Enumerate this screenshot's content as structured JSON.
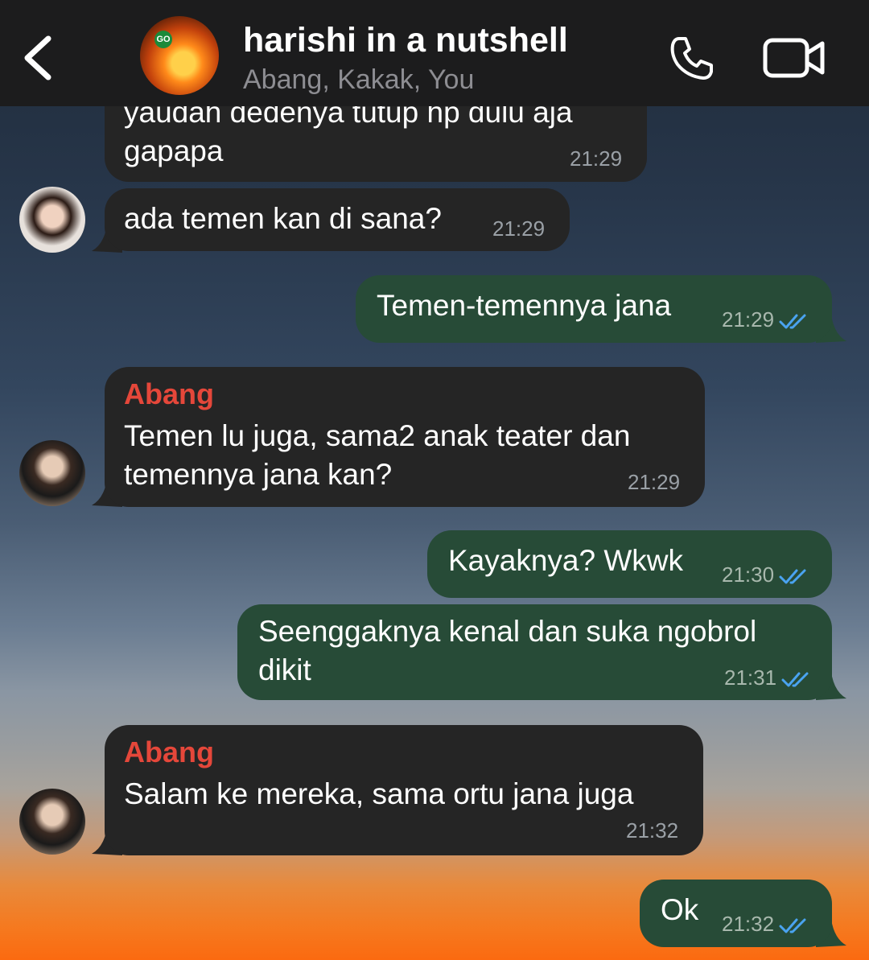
{
  "header": {
    "title": "harishi in a nutshell",
    "subtitle": "Abang, Kakak, You"
  },
  "messages": [
    {
      "type": "in",
      "text": "yaudah dedenya tutup hp dulu aja\ngapapa",
      "time": "21:29"
    },
    {
      "type": "in",
      "text": "ada temen kan di sana?",
      "time": "21:29"
    },
    {
      "type": "out",
      "text": "Temen-temennya jana",
      "time": "21:29",
      "status": "read"
    },
    {
      "type": "in",
      "sender": "Abang",
      "text": "Temen lu juga, sama2 anak teater dan\ntemennya jana kan?",
      "time": "21:29"
    },
    {
      "type": "out",
      "text": "Kayaknya? Wkwk",
      "time": "21:30",
      "status": "read"
    },
    {
      "type": "out",
      "text": "Seenggaknya kenal dan suka ngobrol\ndikit",
      "time": "21:31",
      "status": "read"
    },
    {
      "type": "in",
      "sender": "Abang",
      "text": "Salam ke mereka, sama ortu jana juga",
      "time": "21:32"
    },
    {
      "type": "out",
      "text": "Ok",
      "time": "21:32",
      "status": "read"
    }
  ],
  "colors": {
    "incoming_bubble": "#252525",
    "outgoing_bubble": "#274b37",
    "sender_name": "#e5473a",
    "read_ticks": "#4aa3f0"
  },
  "icons": [
    "back-arrow-icon",
    "phone-icon",
    "video-camera-icon",
    "double-check-icon"
  ]
}
